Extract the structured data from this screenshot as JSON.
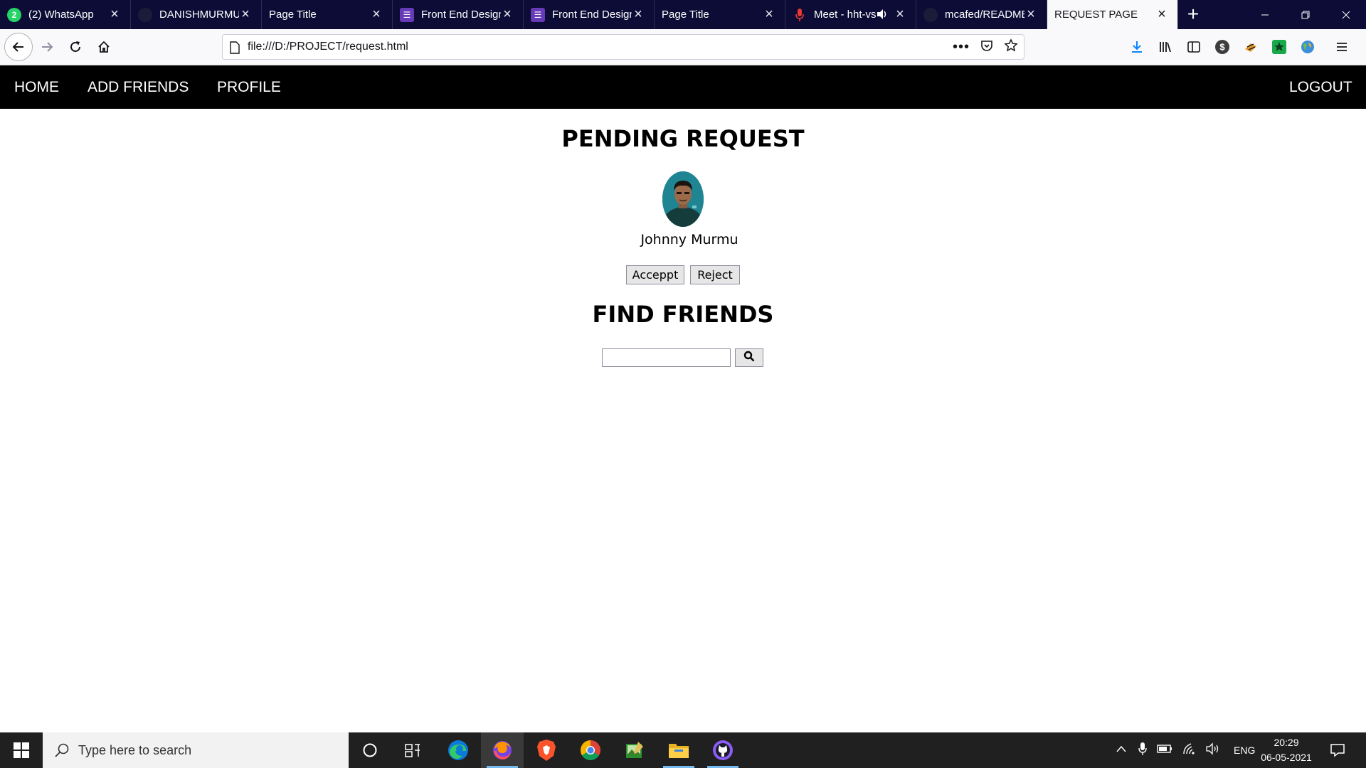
{
  "browser": {
    "tabs": [
      {
        "title": "(2) WhatsApp",
        "icon": "whatsapp-icon",
        "badge": "2"
      },
      {
        "title": "DANISHMURMU",
        "icon": "github-icon"
      },
      {
        "title": "Page Title",
        "icon": "blank-page-icon"
      },
      {
        "title": "Front End Design",
        "icon": "forms-icon"
      },
      {
        "title": "Front End Design",
        "icon": "forms-icon"
      },
      {
        "title": "Page Title",
        "icon": "blank-page-icon"
      },
      {
        "title": "Meet - hht-vs",
        "icon": "microphone-icon"
      },
      {
        "title": "mcafed/README",
        "icon": "github-icon"
      },
      {
        "title": "REQUEST PAGE",
        "icon": "none",
        "active": true
      }
    ],
    "url": "file:///D:/PROJECT/request.html"
  },
  "page": {
    "nav": {
      "home": "HOME",
      "add_friends": "ADD FRIENDS",
      "profile": "PROFILE",
      "logout": "LOGOUT"
    },
    "pending_title": "PENDING REQUEST",
    "request": {
      "name": "Johnny Murmu",
      "accept_label": "Acceppt",
      "reject_label": "Reject"
    },
    "find_title": "FIND FRIENDS",
    "search": {
      "value": "",
      "placeholder": ""
    }
  },
  "taskbar": {
    "search_placeholder": "Type here to search",
    "language": "ENG",
    "time": "20:29",
    "date": "06-05-2021"
  },
  "colors": {
    "tabstrip": "#0c0c36",
    "topnav": "#000000",
    "taskbar": "#202020"
  }
}
